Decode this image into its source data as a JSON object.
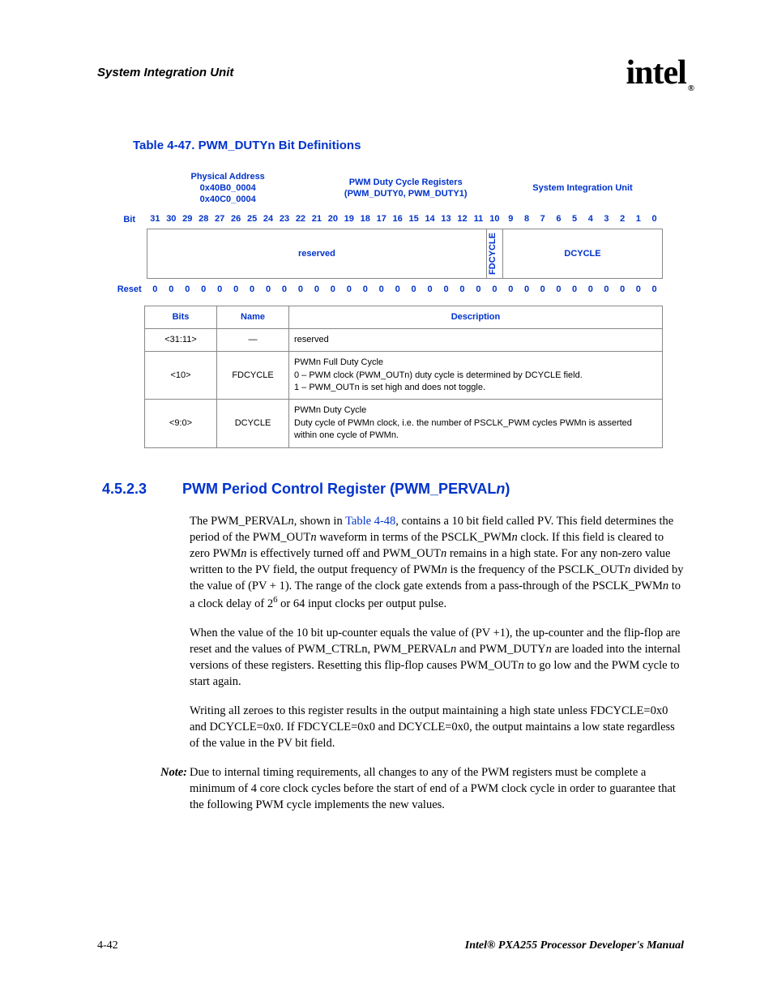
{
  "header": {
    "running_head": "System Integration Unit",
    "logo_text": "intel",
    "logo_r": "®"
  },
  "table_caption": "Table 4-47. PWM_DUTYn Bit Definitions",
  "reg_header": {
    "addr_label": "Physical Address",
    "addr_line1": "0x40B0_0004",
    "addr_line2": "0x40C0_0004",
    "center_line1": "PWM Duty Cycle Registers",
    "center_line2": "(PWM_DUTY0, PWM_DUTY1)",
    "right": "System Integration Unit",
    "bit_label": "Bit",
    "reset_label": "Reset",
    "bits": [
      "31",
      "30",
      "29",
      "28",
      "27",
      "26",
      "25",
      "24",
      "23",
      "22",
      "21",
      "20",
      "19",
      "18",
      "17",
      "16",
      "15",
      "14",
      "13",
      "12",
      "11",
      "10",
      "9",
      "8",
      "7",
      "6",
      "5",
      "4",
      "3",
      "2",
      "1",
      "0"
    ],
    "fields": {
      "reserved": "reserved",
      "fdcycle": "FDCYCLE",
      "dcycle": "DCYCLE"
    },
    "reset_values": [
      "0",
      "0",
      "0",
      "0",
      "0",
      "0",
      "0",
      "0",
      "0",
      "0",
      "0",
      "0",
      "0",
      "0",
      "0",
      "0",
      "0",
      "0",
      "0",
      "0",
      "0",
      "0",
      "0",
      "0",
      "0",
      "0",
      "0",
      "0",
      "0",
      "0",
      "0",
      "0"
    ]
  },
  "desc_table": {
    "headers": {
      "bits": "Bits",
      "name": "Name",
      "desc": "Description"
    },
    "rows": [
      {
        "bits": "<31:11>",
        "name": "—",
        "desc": "reserved"
      },
      {
        "bits": "<10>",
        "name": "FDCYCLE",
        "desc": "PWMn Full Duty Cycle\n0 – PWM clock (PWM_OUTn) duty cycle is determined by DCYCLE field.\n1 – PWM_OUTn is set high and does not toggle."
      },
      {
        "bits": "<9:0>",
        "name": "DCYCLE",
        "desc": "PWMn Duty Cycle\nDuty cycle of PWMn clock, i.e. the number of PSCLK_PWM cycles PWMn is asserted within one cycle of PWMn."
      }
    ]
  },
  "section": {
    "num": "4.5.2.3",
    "title_pre": "PWM Period Control Register (PWM_PERVAL",
    "title_ital": "n",
    "title_post": ")"
  },
  "para1": {
    "t1": "The PWM_PERVAL",
    "n": "n",
    "t2": ", shown in ",
    "link": "Table 4-48",
    "t3": ", contains a 10 bit field called PV. This field determines the period of the PWM_OUT",
    "t4": " waveform in terms of the PSCLK_PWM",
    "t5": " clock. If this field is cleared to zero PWM",
    "t6": " is effectively turned off and PWM_OUT",
    "t7": " remains in a high state. For any non-zero value written to the PV field, the output frequency of PWM",
    "t8": " is the frequency of the PSCLK_OUT",
    "t9": " divided by the value of (PV + 1). The range of the clock gate extends from a pass-through of the PSCLK_PWM",
    "t10": " to a clock delay of 2",
    "sup": "6",
    "t11": " or 64 input clocks per output pulse."
  },
  "para2": {
    "t1": "When the value of the 10 bit up-counter equals the value of (PV +1), the up-counter and the flip-flop are reset and the values of PWM_CTRLn, PWM_PERVAL",
    "n": "n",
    "t2": " and PWM_DUTY",
    "t3": " are loaded into the internal versions of these registers. Resetting this flip-flop causes PWM_OUT",
    "t4": " to go low and the PWM cycle to start again."
  },
  "para3": "Writing all zeroes to this register results in the output maintaining a high state unless FDCYCLE=0x0 and DCYCLE=0x0. If FDCYCLE=0x0 and DCYCLE=0x0, the output maintains a low state regardless of the value in the PV bit field.",
  "note": {
    "label": "Note:",
    "body": "Due to internal timing requirements, all changes to any of the PWM registers must be complete a minimum of 4 core clock cycles before the start of end of a PWM clock cycle in order to guarantee that the following PWM cycle implements the new values."
  },
  "footer": {
    "page": "4-42",
    "manual": "Intel® PXA255 Processor Developer's Manual"
  }
}
